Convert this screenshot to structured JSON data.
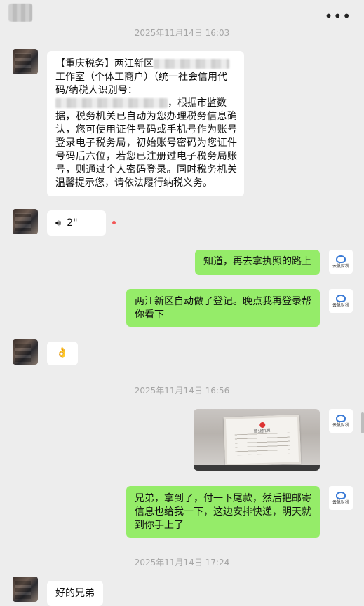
{
  "header": {
    "title_blurred": "",
    "more_icon": "more-dots-icon"
  },
  "timestamps": [
    "2025年11月14日 16:03",
    "2025年11月14日 16:56",
    "2025年11月14日 17:24"
  ],
  "messages": {
    "m1": {
      "line1_prefix": "【重庆税务】两江新区",
      "line2": "工作室（个体工商户）（统一社会信用代",
      "line3": "码/纳税人识别号：",
      "line4_suffix": "，根据市监数",
      "rest": "据，税务机关已自动为您办理税务信息确认，您可使用证件号码或手机号作为账号登录电子税务局，初始账号密码为您证件号码后六位，若您已注册过电子税务局账号，则通过个人密码登录。同时税务机关温馨提示您，请依法履行纳税义务。"
    },
    "m2": {
      "voice_duration": "2\"",
      "voice_icon": "voice-wave-icon"
    },
    "m3": {
      "text": "知道，再去拿执照的路上"
    },
    "m4": {
      "text": "两江新区自动做了登记。晚点我再登录帮你看下"
    },
    "m5": {
      "emoji": "👌"
    },
    "m6": {
      "image_caption": "营业执照"
    },
    "m7": {
      "text": "兄弟，拿到了，付一下尾款，然后把邮寄信息也给我一下，这边安排快递，明天就到你手上了"
    },
    "m8": {
      "text": "好的兄弟"
    }
  },
  "self_avatar_label": "云帆财税",
  "colors": {
    "background": "#EDEDED",
    "incoming_bubble": "#FFFFFF",
    "outgoing_bubble": "#95EC69",
    "timestamp": "#A6A6A6",
    "unread_dot": "#F25757"
  }
}
